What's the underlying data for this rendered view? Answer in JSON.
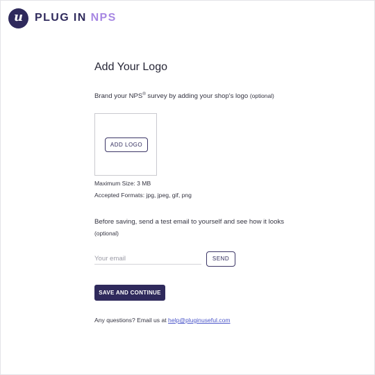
{
  "brand": {
    "logo_letter": "u",
    "name_main": "PLUG IN",
    "name_accent": "NPS",
    "primary_color": "#2f2a5c",
    "accent_color": "#a787e3"
  },
  "page": {
    "title": "Add Your Logo",
    "intro_prefix": "Brand your NPS",
    "intro_sup": "®",
    "intro_suffix": " survey by adding your shop's logo ",
    "intro_optional": "(optional)"
  },
  "logo_upload": {
    "button_label": "ADD LOGO",
    "max_size": "Maximum Size: 3 MB",
    "formats": "Accepted Formats: jpg, jpeg, gif, png"
  },
  "test_email": {
    "title": "Before saving, send a test email to yourself and see how it looks",
    "optional": "(optional)",
    "placeholder": "Your email",
    "value": "",
    "send_label": "SEND"
  },
  "actions": {
    "save_label": "SAVE AND CONTINUE"
  },
  "footer": {
    "questions_text": "Any questions? Email us at ",
    "email_link": "help@pluginuseful.com",
    "link_color": "#4a55c9"
  }
}
